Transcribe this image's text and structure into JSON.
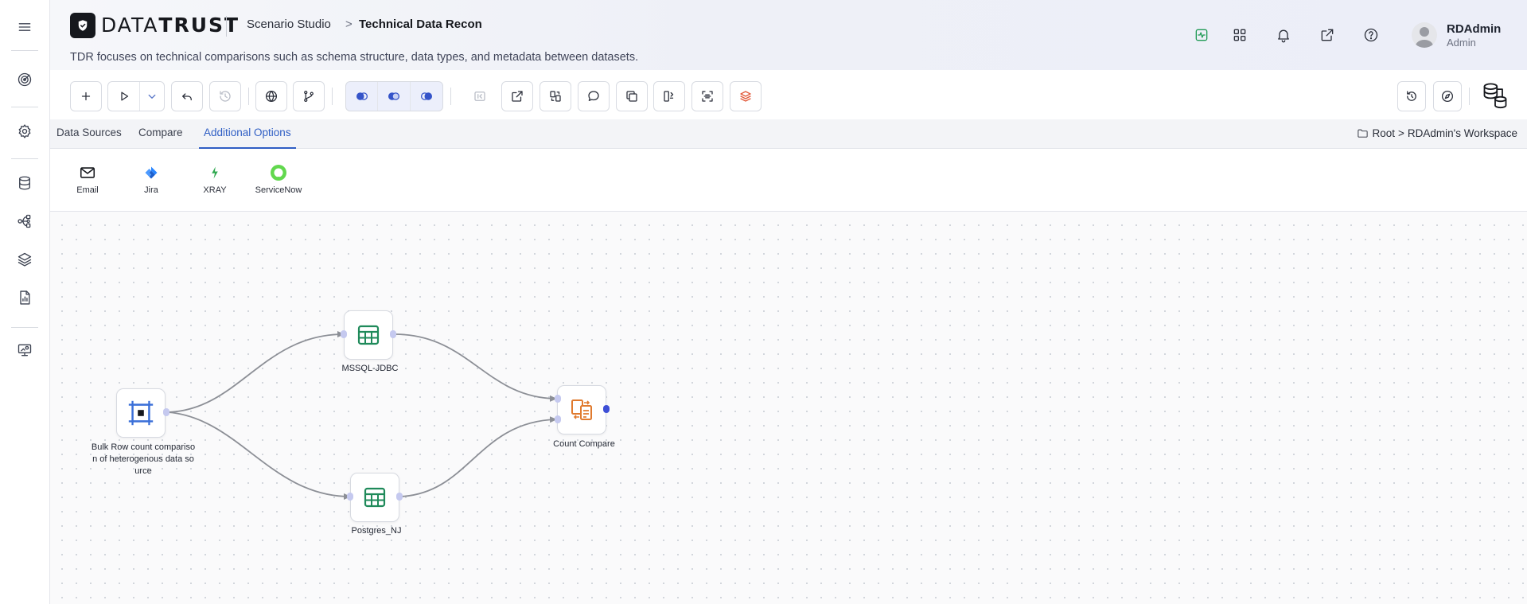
{
  "brand": {
    "name_bold": "DATA",
    "name_light": "TRUST"
  },
  "header": {
    "breadcrumb_1": "Scenario Studio",
    "breadcrumb_sep": ">",
    "breadcrumb_2": "Technical Data Recon",
    "subtitle": "TDR focuses on technical comparisons such as schema structure, data types, and metadata between datasets."
  },
  "user": {
    "name": "RDAdmin",
    "role": "Admin"
  },
  "header_icons": [
    "activity-icon",
    "apps-grid-icon",
    "bell-icon",
    "external-link-icon",
    "help-icon"
  ],
  "sidebar": {
    "items": [
      "menu-icon",
      "target-icon",
      "settings-icon",
      "database-icon",
      "workflow-icon",
      "layers-icon",
      "report-icon",
      "monitor-icon"
    ]
  },
  "tabs": [
    {
      "label": "Data Sources",
      "active": false
    },
    {
      "label": "Compare",
      "active": false
    },
    {
      "label": "Additional Options",
      "active": true
    }
  ],
  "workspace": {
    "root": "Root",
    "sep": ">",
    "name": "RDAdmin's Workspace"
  },
  "options": [
    {
      "label": "Email",
      "icon": "mail-icon"
    },
    {
      "label": "Jira",
      "icon": "jira-icon"
    },
    {
      "label": "XRAY",
      "icon": "xray-icon"
    },
    {
      "label": "ServiceNow",
      "icon": "servicenow-icon"
    }
  ],
  "nodes": {
    "source": {
      "label_line1": "Bulk Row count compariso",
      "label_line2": "n of heterogenous data so",
      "label_line3": "urce"
    },
    "mssql": {
      "label": "MSSQL-JDBC"
    },
    "postgres": {
      "label": "Postgres_NJ"
    },
    "compare": {
      "label": "Count Compare"
    }
  },
  "colors": {
    "accent": "#2f5ec4",
    "table_icon": "#1f8a5a",
    "compare_icon": "#e07a2e",
    "source_icon": "#3a6fd8",
    "edge": "#8c8f96",
    "port": "#c5c9ef",
    "port_active": "#3e4fd6"
  }
}
